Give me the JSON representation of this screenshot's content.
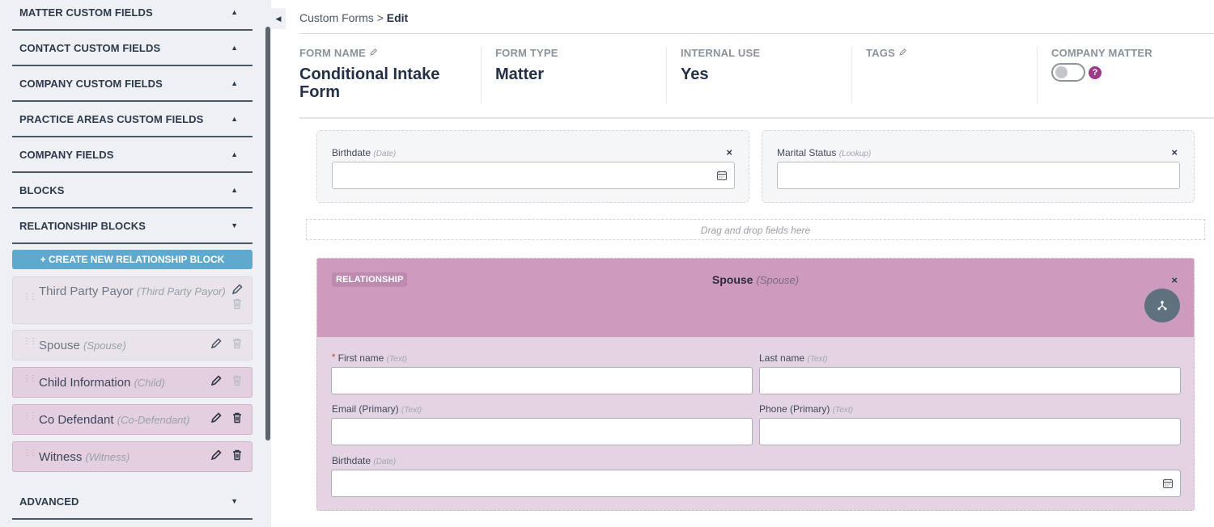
{
  "sidebar": {
    "sections": [
      {
        "label": "MATTER CUSTOM FIELDS",
        "state": "collapsed"
      },
      {
        "label": "CONTACT CUSTOM FIELDS",
        "state": "collapsed"
      },
      {
        "label": "COMPANY CUSTOM FIELDS",
        "state": "collapsed"
      },
      {
        "label": "PRACTICE AREAS CUSTOM FIELDS",
        "state": "collapsed"
      },
      {
        "label": "COMPANY FIELDS",
        "state": "collapsed"
      },
      {
        "label": "BLOCKS",
        "state": "collapsed"
      },
      {
        "label": "RELATIONSHIP BLOCKS",
        "state": "expanded"
      }
    ],
    "caret_up": "▲",
    "caret_down": "▼",
    "create_button": "+ CREATE NEW RELATIONSHIP BLOCK",
    "relationship_blocks": [
      {
        "name": "Third Party Payor",
        "type": "(Third Party Payor)",
        "state": "disabled"
      },
      {
        "name": "Spouse",
        "type": "(Spouse)",
        "state": "disabled"
      },
      {
        "name": "Child Information",
        "type": "(Child)",
        "state": "active"
      },
      {
        "name": "Co Defendant",
        "type": "(Co-Defendant)",
        "state": "active"
      },
      {
        "name": "Witness",
        "type": "(Witness)",
        "state": "active"
      }
    ],
    "advanced": {
      "label": "ADVANCED",
      "state": "expanded"
    },
    "grip": "⋮⋮",
    "collapse_glyph": "◀"
  },
  "breadcrumb": {
    "parent": "Custom Forms",
    "separator": ">",
    "current": "Edit"
  },
  "meta": {
    "form_name": {
      "label": "FORM NAME",
      "value": "Conditional Intake Form"
    },
    "form_type": {
      "label": "FORM TYPE",
      "value": "Matter"
    },
    "internal_use": {
      "label": "INTERNAL USE",
      "value": "Yes"
    },
    "tags": {
      "label": "TAGS",
      "value": ""
    },
    "company_matter": {
      "label": "COMPANY MATTER",
      "toggle_on": false,
      "help": "?"
    }
  },
  "fields": [
    {
      "label": "Birthdate",
      "type": "(Date)",
      "close": "×"
    },
    {
      "label": "Marital Status",
      "type": "(Lookup)",
      "close": "×"
    }
  ],
  "dropzone": "Drag and drop fields here",
  "relationship": {
    "badge": "RELATIONSHIP",
    "title": "Spouse",
    "type": "(Spouse)",
    "close": "×",
    "fields": [
      {
        "label": "First name",
        "type": "(Text)",
        "required": "*"
      },
      {
        "label": "Last name",
        "type": "(Text)"
      },
      {
        "label": "Email (Primary)",
        "type": "(Text)"
      },
      {
        "label": "Phone (Primary)",
        "type": "(Text)"
      },
      {
        "label": "Birthdate",
        "type": "(Date)"
      }
    ]
  },
  "colors": {
    "accent_blue": "#5fa9cf",
    "relationship_pink": "#cc9bbe",
    "help_purple": "#9c3b8a"
  }
}
